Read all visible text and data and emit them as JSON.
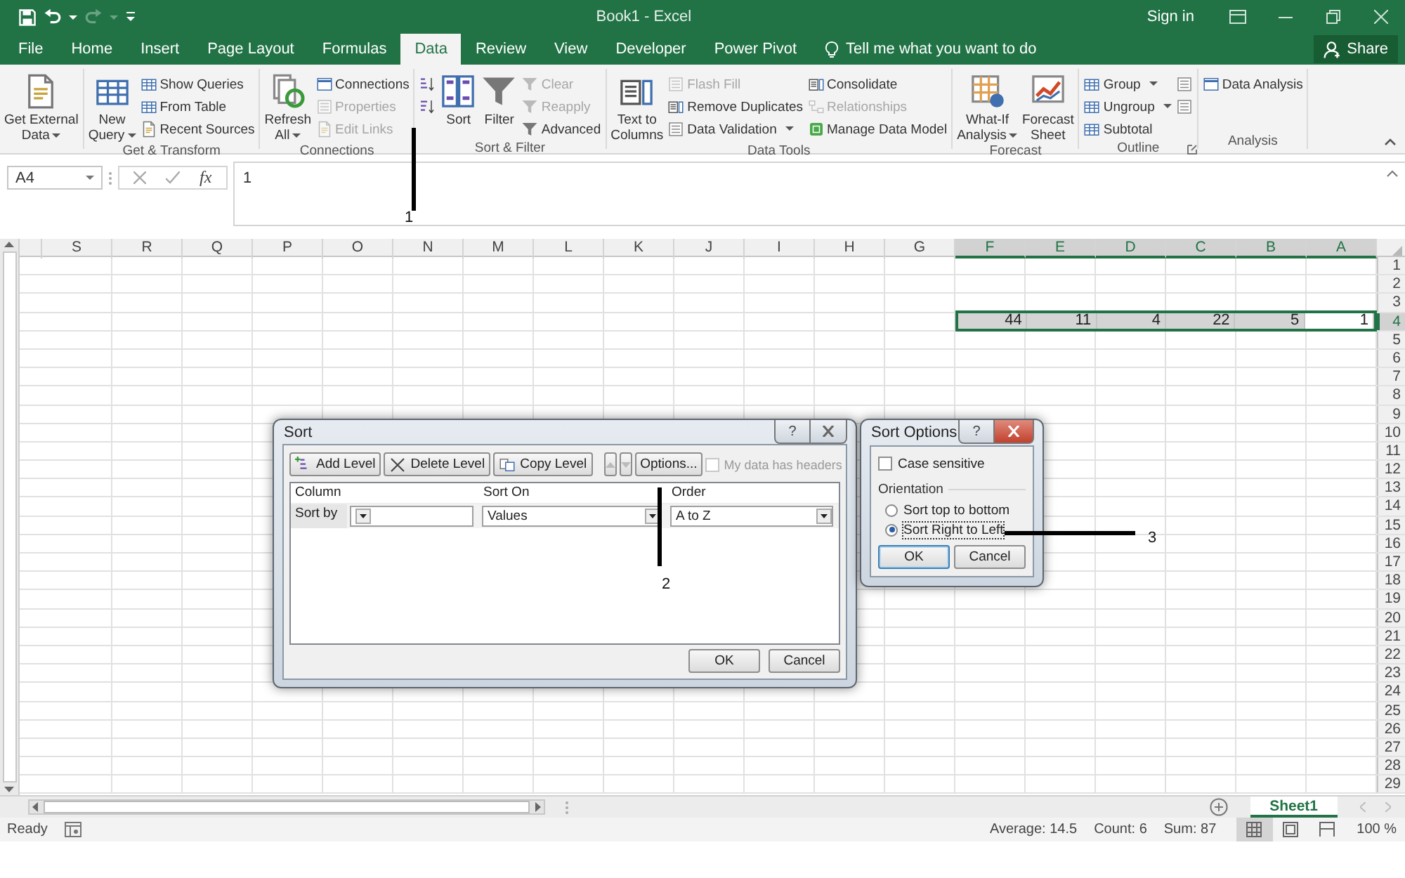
{
  "window": {
    "title": "Book1 - Excel",
    "sign_in": "Sign in"
  },
  "ribbon_tabs": [
    {
      "label": "File",
      "selected": false
    },
    {
      "label": "Home",
      "selected": false
    },
    {
      "label": "Insert",
      "selected": false
    },
    {
      "label": "Page Layout",
      "selected": false
    },
    {
      "label": "Formulas",
      "selected": false
    },
    {
      "label": "Data",
      "selected": true
    },
    {
      "label": "Review",
      "selected": false
    },
    {
      "label": "View",
      "selected": false
    },
    {
      "label": "Developer",
      "selected": false
    },
    {
      "label": "Power Pivot",
      "selected": false
    }
  ],
  "tell_me": {
    "placeholder": "Tell me what you want to do"
  },
  "share_button": {
    "label": "Share"
  },
  "ribbon_groups": [
    {
      "columns": [
        {
          "kind": "large",
          "label": "Get External\nData",
          "disabled": false,
          "dropdown": true
        }
      ]
    },
    {
      "label": "Get & Transform",
      "columns": [
        {
          "kind": "large",
          "label": "New\nQuery",
          "disabled": false,
          "dropdown": true
        },
        {
          "kind": "stack",
          "items": [
            {
              "label": "Show Queries",
              "disabled": false,
              "dropdown": false
            },
            {
              "label": "From Table",
              "disabled": false,
              "dropdown": false
            },
            {
              "label": "Recent Sources",
              "disabled": false,
              "dropdown": false
            }
          ]
        }
      ]
    },
    {
      "label": "Connections",
      "columns": [
        {
          "kind": "large",
          "label": "Refresh\nAll",
          "disabled": false,
          "dropdown": true
        },
        {
          "kind": "stack",
          "items": [
            {
              "label": "Connections",
              "disabled": false,
              "dropdown": false
            },
            {
              "label": "Properties",
              "disabled": true,
              "dropdown": false
            },
            {
              "label": "Edit Links",
              "disabled": true,
              "dropdown": false
            }
          ]
        }
      ]
    },
    {
      "label": "Sort & Filter",
      "columns": [
        {
          "kind": "stack",
          "items": [
            {
              "disabled": false
            },
            {
              "disabled": false
            }
          ]
        },
        {
          "kind": "large",
          "label": "Sort",
          "disabled": false,
          "dropdown": false
        },
        {
          "kind": "large",
          "label": "Filter",
          "disabled": false,
          "dropdown": false
        },
        {
          "kind": "stack",
          "items": [
            {
              "label": "Clear",
              "disabled": true,
              "dropdown": false
            },
            {
              "label": "Reapply",
              "disabled": true,
              "dropdown": false
            },
            {
              "label": "Advanced",
              "disabled": false,
              "dropdown": false
            }
          ]
        }
      ]
    },
    {
      "label": "Data Tools",
      "columns": [
        {
          "kind": "large",
          "label": "Text to\nColumns",
          "disabled": false,
          "dropdown": false
        },
        {
          "kind": "stack",
          "items": [
            {
              "label": "Flash Fill",
              "disabled": true,
              "dropdown": false
            },
            {
              "label": "Remove Duplicates",
              "disabled": false,
              "dropdown": false
            },
            {
              "label": "Data Validation",
              "disabled": false,
              "dropdown": true
            }
          ]
        },
        {
          "kind": "stack",
          "items": [
            {
              "label": "Consolidate",
              "disabled": false,
              "dropdown": false
            },
            {
              "label": "Relationships",
              "disabled": true,
              "dropdown": false
            },
            {
              "label": "Manage Data Model",
              "disabled": false,
              "dropdown": false
            }
          ]
        }
      ]
    },
    {
      "label": "Forecast",
      "columns": [
        {
          "kind": "large",
          "label": "What-If\nAnalysis",
          "disabled": false,
          "dropdown": true
        },
        {
          "kind": "large",
          "label": "Forecast\nSheet",
          "disabled": false,
          "dropdown": false
        }
      ]
    },
    {
      "label": "Outline",
      "launcher": true,
      "columns": [
        {
          "kind": "stack",
          "items": [
            {
              "label": "Group",
              "disabled": false,
              "dropdown": true
            },
            {
              "label": "Ungroup",
              "disabled": false,
              "dropdown": true
            },
            {
              "label": "Subtotal",
              "disabled": false,
              "dropdown": false
            }
          ]
        },
        {
          "kind": "stack",
          "items": [
            {
              "disabled": false
            },
            {
              "disabled": false
            }
          ]
        }
      ]
    },
    {
      "label": "Analysis",
      "columns": [
        {
          "kind": "stack",
          "items": [
            {
              "label": "Data Analysis",
              "disabled": false,
              "dropdown": false
            }
          ]
        }
      ]
    }
  ],
  "formula_bar": {
    "name_box": "A4",
    "function_label": "fx",
    "value": "1"
  },
  "sheet": {
    "columns": [
      {
        "label": "S",
        "selected": false
      },
      {
        "label": "R",
        "selected": false
      },
      {
        "label": "Q",
        "selected": false
      },
      {
        "label": "P",
        "selected": false
      },
      {
        "label": "O",
        "selected": false
      },
      {
        "label": "N",
        "selected": false
      },
      {
        "label": "M",
        "selected": false
      },
      {
        "label": "L",
        "selected": false
      },
      {
        "label": "K",
        "selected": false
      },
      {
        "label": "J",
        "selected": false
      },
      {
        "label": "I",
        "selected": false
      },
      {
        "label": "H",
        "selected": false
      },
      {
        "label": "G",
        "selected": false
      },
      {
        "label": "F",
        "selected": true
      },
      {
        "label": "E",
        "selected": true
      },
      {
        "label": "D",
        "selected": true
      },
      {
        "label": "C",
        "selected": true
      },
      {
        "label": "B",
        "selected": true
      },
      {
        "label": "A",
        "selected": true
      }
    ],
    "rows": [
      {
        "label": "1",
        "selected": false
      },
      {
        "label": "2",
        "selected": false
      },
      {
        "label": "3",
        "selected": false
      },
      {
        "label": "4",
        "selected": true,
        "cells": [
          {
            "value": "44",
            "selected": true,
            "active": false
          },
          {
            "value": "11",
            "selected": true,
            "active": false
          },
          {
            "value": "4",
            "selected": true,
            "active": false
          },
          {
            "value": "22",
            "selected": true,
            "active": false
          },
          {
            "value": "5",
            "selected": true,
            "active": false
          },
          {
            "value": "1",
            "selected": true,
            "active": true
          }
        ]
      },
      {
        "label": "5",
        "selected": false
      },
      {
        "label": "6",
        "selected": false
      },
      {
        "label": "7",
        "selected": false
      },
      {
        "label": "8",
        "selected": false
      },
      {
        "label": "9",
        "selected": false
      },
      {
        "label": "10",
        "selected": false
      },
      {
        "label": "11",
        "selected": false
      },
      {
        "label": "12",
        "selected": false
      },
      {
        "label": "13",
        "selected": false
      },
      {
        "label": "14",
        "selected": false
      },
      {
        "label": "15",
        "selected": false
      },
      {
        "label": "16",
        "selected": false
      },
      {
        "label": "17",
        "selected": false
      },
      {
        "label": "18",
        "selected": false
      },
      {
        "label": "19",
        "selected": false
      },
      {
        "label": "20",
        "selected": false
      },
      {
        "label": "21",
        "selected": false
      },
      {
        "label": "22",
        "selected": false
      },
      {
        "label": "23",
        "selected": false
      },
      {
        "label": "24",
        "selected": false
      },
      {
        "label": "25",
        "selected": false
      },
      {
        "label": "26",
        "selected": false
      },
      {
        "label": "27",
        "selected": false
      },
      {
        "label": "28",
        "selected": false
      },
      {
        "label": "29",
        "selected": false
      }
    ]
  },
  "sheet_tabs": [
    {
      "label": "Sheet1",
      "selected": true
    }
  ],
  "status_bar": {
    "mode": "Ready",
    "summaries": [
      "Average: 14.5",
      "Count: 6",
      "Sum: 87"
    ],
    "views": [
      {
        "selected": true
      },
      {
        "selected": false
      },
      {
        "selected": false
      }
    ],
    "zoom": "100 %"
  },
  "sort_dialog": {
    "title": "Sort",
    "help": "?",
    "toolbar": [
      {
        "kind": "text",
        "label": "Add Level",
        "disabled": false
      },
      {
        "kind": "text",
        "label": "Delete Level",
        "disabled": false
      },
      {
        "kind": "text",
        "label": "Copy Level",
        "disabled": false
      },
      {
        "kind": "separator"
      },
      {
        "kind": "move-up",
        "disabled": true
      },
      {
        "kind": "move-down",
        "disabled": true
      },
      {
        "kind": "text",
        "label": "Options...",
        "disabled": false
      }
    ],
    "headers_checkbox": {
      "label": "My data has headers",
      "checked": false,
      "disabled": true
    },
    "columns": [
      "Column",
      "Sort On",
      "Order"
    ],
    "levels": [
      {
        "label": "Sort by",
        "sort_on": "Values",
        "order": "A to Z"
      }
    ],
    "buttons": [
      "OK",
      "Cancel"
    ]
  },
  "sort_options_dialog": {
    "title": "Sort Options",
    "help": "?",
    "case_sensitive": {
      "label": "Case sensitive",
      "checked": false
    },
    "orientation": {
      "label": "Orientation",
      "options": [
        {
          "label": "Sort top to bottom",
          "selected": false
        },
        {
          "label": "Sort Right to Left",
          "selected": true
        }
      ]
    },
    "buttons": [
      "OK",
      "Cancel"
    ]
  },
  "annotations": [
    {
      "label": "1"
    },
    {
      "label": "2"
    },
    {
      "label": "3"
    }
  ]
}
